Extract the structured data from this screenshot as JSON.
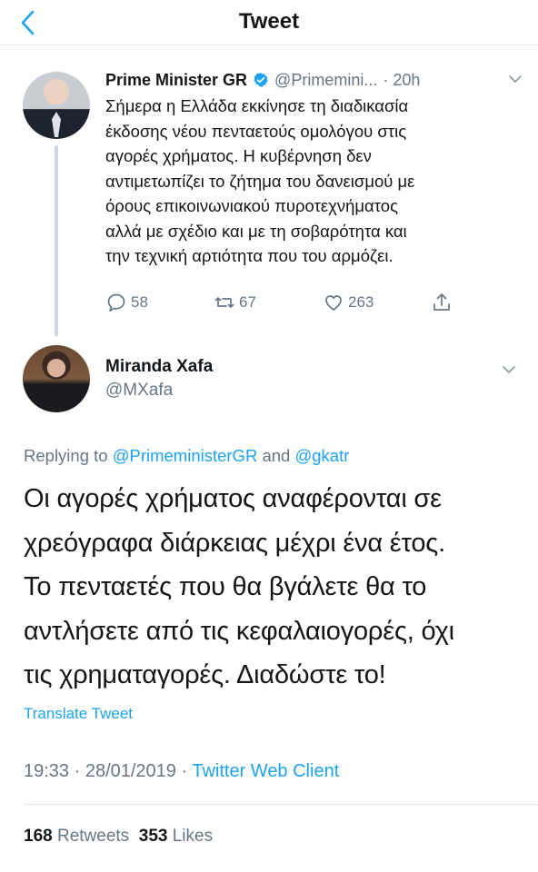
{
  "header": {
    "title": "Tweet",
    "back_icon": "chevron-left-icon"
  },
  "parent_tweet": {
    "author_name": "Prime Minister GR",
    "verified": true,
    "handle": "@Primemini...",
    "time": "· 20h",
    "lines": [
      "Σήμερα η Ελλάδα εκκίνησε τη διαδικασία",
      "έκδοσης νέου πενταετούς ομολόγου στις",
      "αγορές χρήματος. Η κυβέρνηση δεν",
      "αντιμετωπίζει το ζήτημα του δανεισμού με",
      "όρους επικοινωνιακού πυροτεχνήματος",
      "αλλά με σχέδιο και με τη σοβαρότητα και",
      "την τεχνική αρτιότητα που του αρμόζει."
    ],
    "replies": "58",
    "retweets": "67",
    "likes": "263"
  },
  "reply_tweet": {
    "author_name": "Miranda Xafa",
    "handle": "@MXafa",
    "replying_prefix": "Replying to ",
    "replying_mention_1": "@PrimeministerGR",
    "replying_and": " and ",
    "replying_mention_2": "@gkatr",
    "lines": [
      "Οι αγορές χρήματος αναφέρονται σε",
      "χρεόγραφα διάρκειας μέχρι ένα έτος.",
      "Το πενταετές που θα βγάλετε θα το",
      "αντλήσετε από τις κεφαλαιογορές, όχι",
      "τις χρηματαγορές. Διαδώστε το!"
    ],
    "translate_label": "Translate Tweet",
    "timestamp": "19:33 · 28/01/2019 · ",
    "client": "Twitter Web Client",
    "retweet_count": "168",
    "retweet_label": "Retweets",
    "like_count": "353",
    "like_label": "Likes"
  },
  "colors": {
    "accent": "#1da1f2",
    "secondary_text": "#657786",
    "primary_text": "#14171a"
  }
}
